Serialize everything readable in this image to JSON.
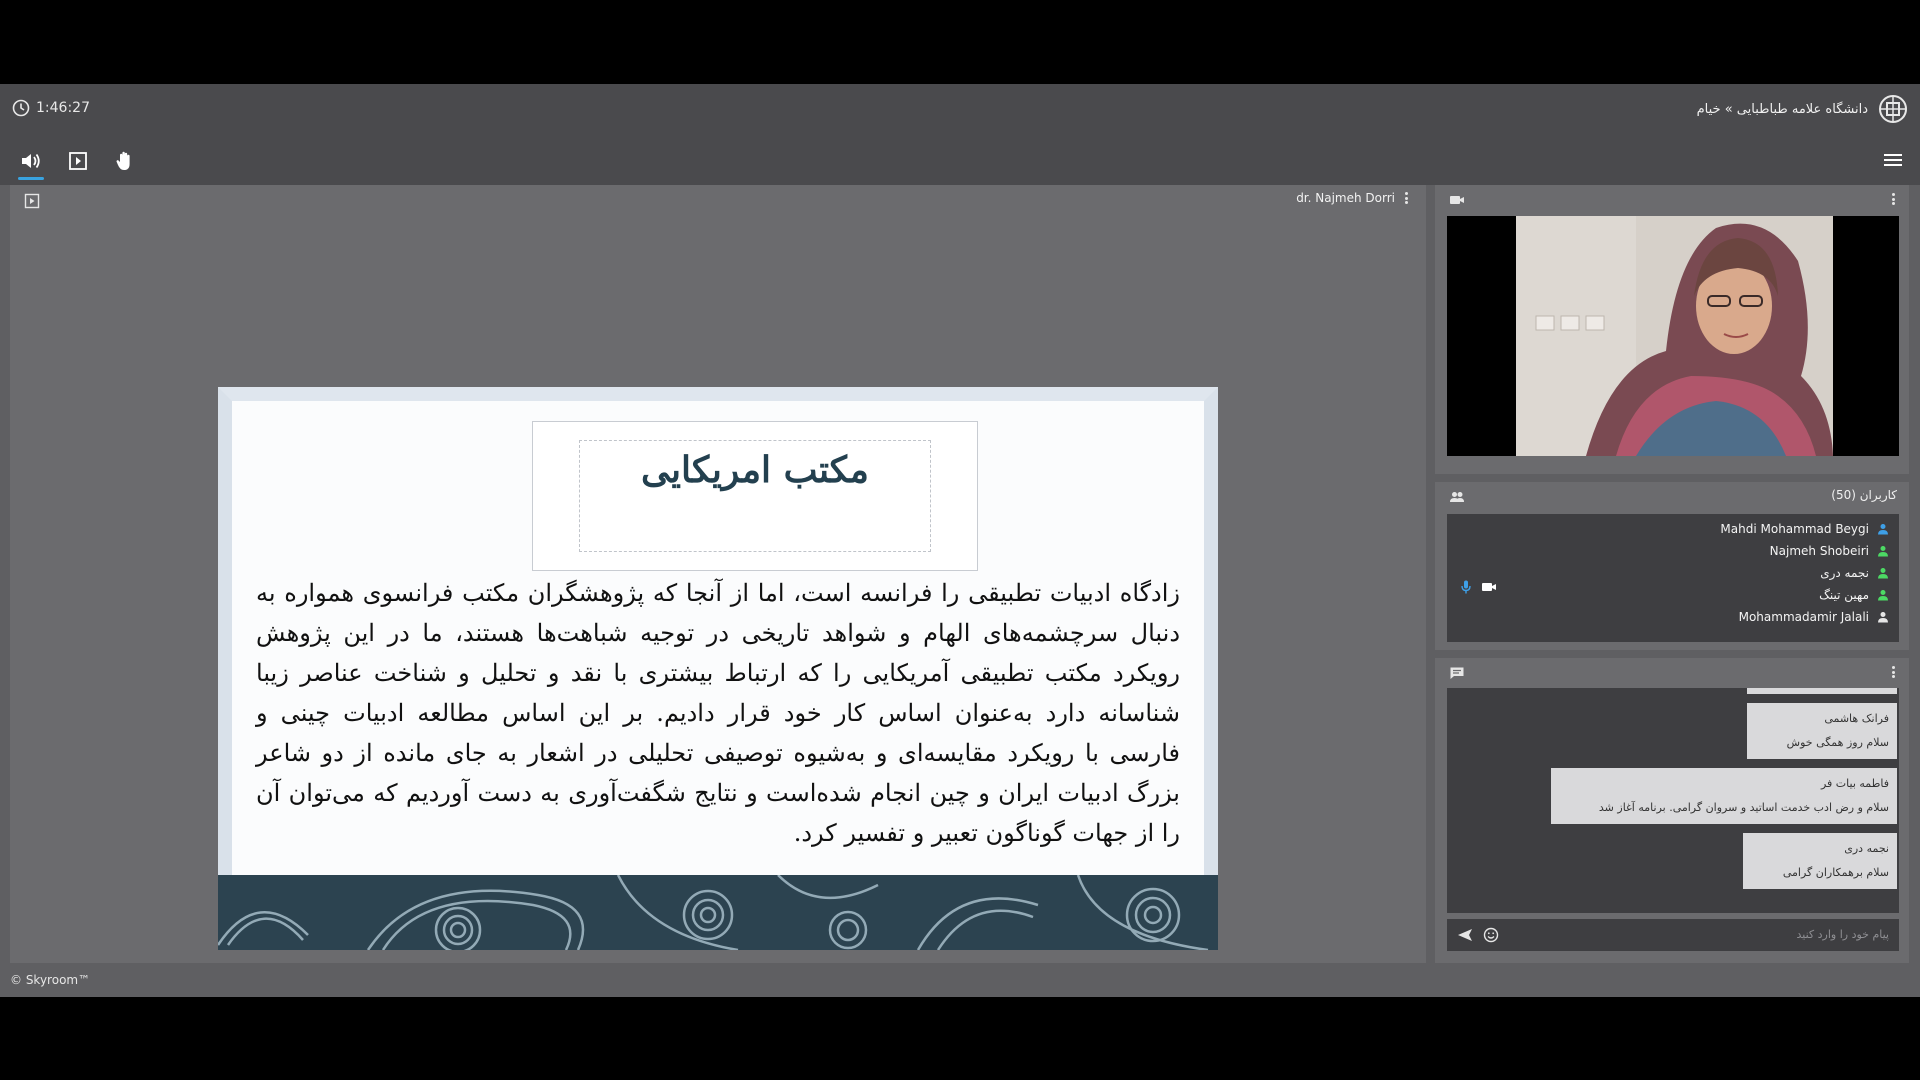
{
  "header": {
    "timer": "1:46:27",
    "breadcrumb": "دانشگاه علامه طباطبایی » خیام",
    "timer_icon": "clock-icon",
    "logo_icon": "university-logo"
  },
  "toolbar": {
    "items": [
      "speaker-icon",
      "screen-share-icon",
      "raise-hand-icon"
    ],
    "menu_icon": "hamburger-menu-icon"
  },
  "presentation": {
    "presenter_name": "dr. Najmeh Dorri",
    "slide_title": "مکتب امریکایی",
    "slide_body": "زادگاه ادبیات تطبیقی را فرانسه است، اما از آنجا که پژوهشگران مکتب فرانسوی همواره به دنبال سرچشمه‌های الهام و شواهد تاریخی در توجیه  شباهت‌ها هستند، ما در این پژوهش رویکرد مکتب تطبیقی آمریکایی را که ارتباط بیشتری با نقد و تحلیل و شناخت عناصر زیبا شناسانه دارد به‌عنوان اساس کار خود قرار دادیم. بر این اساس مطالعه ادبیات چینی و فارسی با رویکرد مقایسه‌ای و به‌شیوه توصیفی تحلیلی در اشعار به جای مانده از دو شاعر بزرگ ادبیات ایران و چین انجام شده‌است و نتایج شگفت‌آوری به دست آوردیم که می‌توان آن را از جهات گوناگون تعبیر و تفسیر  کرد."
  },
  "users": {
    "title": "کاربران (50)",
    "list": [
      {
        "name": "Mahdi Mohammad Beygi",
        "color": "#3ea0e8"
      },
      {
        "name": "Najmeh Shobeiri",
        "color": "#4cd964"
      },
      {
        "name": "نجمه دری",
        "color": "#4cd964"
      },
      {
        "name": "مهین تینگ",
        "color": "#4cd964"
      },
      {
        "name": "Mohammadamir Jalali",
        "color": "#e6e6e6"
      }
    ]
  },
  "chat": {
    "messages": [
      {
        "sender": "فرانک هاشمی",
        "text": "سلام روز همگی خوش"
      },
      {
        "sender": "فاطمه بیات فر",
        "text": "سلام و رض ادب خدمت اساتید و سروان گرامی. برنامه آغاز شد"
      },
      {
        "sender": "نجمه دری",
        "text": "سلام برهمکاران گرامی"
      }
    ],
    "input_placeholder": "پیام خود را وارد کنید"
  },
  "footer": {
    "copyright": "© Skyroom™"
  },
  "colors": {
    "accent": "#39a3e0",
    "panel_bg": "#6b6b6e",
    "bar_bg": "#4a4a4d"
  }
}
